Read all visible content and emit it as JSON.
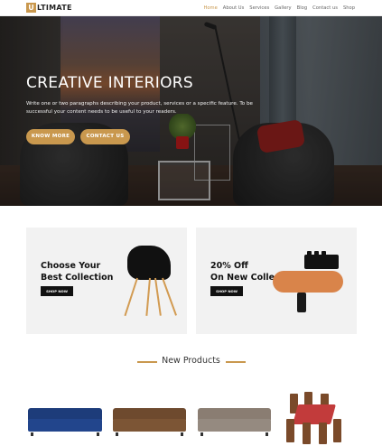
{
  "brand": {
    "mark": "U",
    "name": "LTIMATE"
  },
  "nav": {
    "items": [
      {
        "label": "Home",
        "active": true
      },
      {
        "label": "About Us",
        "active": false
      },
      {
        "label": "Services",
        "active": false
      },
      {
        "label": "Gallery",
        "active": false
      },
      {
        "label": "Blog",
        "active": false
      },
      {
        "label": "Contact us",
        "active": false
      },
      {
        "label": "Shop",
        "active": false
      }
    ]
  },
  "hero": {
    "title": "CREATIVE INTERIORS",
    "text": "Write one or two paragraphs describing your product, services or a specific feature. To be successful your content needs to be useful to your readers.",
    "primary_button": "KNOW MORE",
    "secondary_button": "CONTACT US"
  },
  "promos": [
    {
      "line1": "Choose Your",
      "line2": "Best Collection",
      "button": "SHOP NOW"
    },
    {
      "line1": "20% Off",
      "line2": "On New Collection",
      "button": "SHOP NOW"
    }
  ],
  "products": {
    "title": "New Products"
  },
  "colors": {
    "accent": "#c9984e",
    "dark": "#111111",
    "card_bg": "#f2f2f2"
  }
}
